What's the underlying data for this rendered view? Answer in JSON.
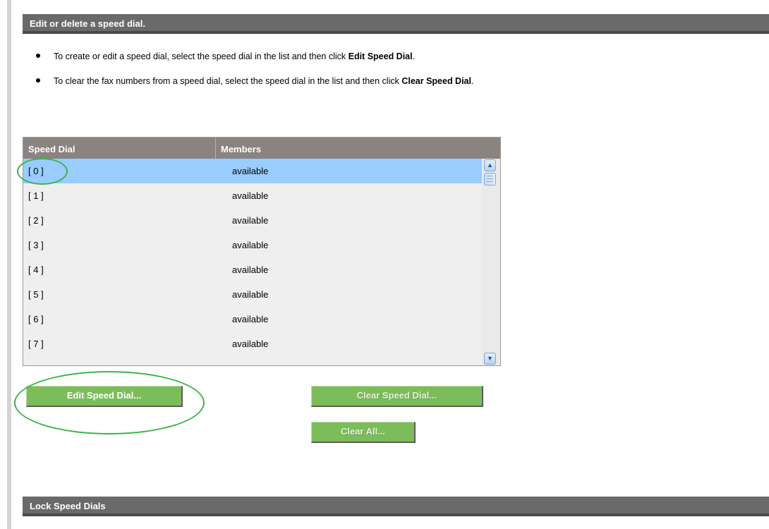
{
  "sections": {
    "edit_header": "Edit or delete a speed dial.",
    "lock_header": "Lock Speed Dials"
  },
  "instructions": [
    {
      "text": "To create or edit a speed dial, select the speed dial in the list and then click ",
      "bold": "Edit Speed Dial",
      "end": "."
    },
    {
      "text": "To clear the fax numbers from a speed dial, select the speed dial in the list and then click ",
      "bold": "Clear Speed Dial",
      "end": "."
    }
  ],
  "table": {
    "columns": [
      "Speed Dial",
      "Members"
    ],
    "rows": [
      {
        "id": "[ 0 ]",
        "members": "available",
        "selected": true
      },
      {
        "id": "[ 1 ]",
        "members": "available"
      },
      {
        "id": "[ 2 ]",
        "members": "available"
      },
      {
        "id": "[ 3 ]",
        "members": "available"
      },
      {
        "id": "[ 4 ]",
        "members": "available"
      },
      {
        "id": "[ 5 ]",
        "members": "available"
      },
      {
        "id": "[ 6 ]",
        "members": "available"
      },
      {
        "id": "[ 7 ]",
        "members": "available"
      }
    ]
  },
  "buttons": {
    "edit": "Edit Speed Dial...",
    "clear": "Clear Speed Dial...",
    "clear_all": "Clear All..."
  },
  "colors": {
    "header_bg": "#6a6a6a",
    "table_header_bg": "#8a8380",
    "selected_row": "#99ccff",
    "button_green": "#7cbd5a",
    "annotation_green": "#3ab54a"
  }
}
